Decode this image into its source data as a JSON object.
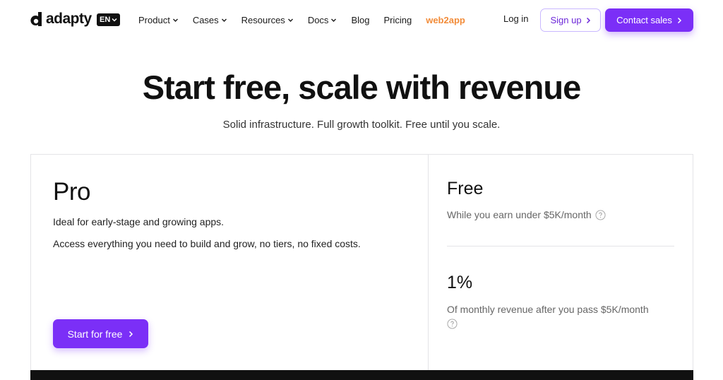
{
  "header": {
    "logo_text": "adapty",
    "language": "EN",
    "nav": [
      {
        "label": "Product",
        "dropdown": true
      },
      {
        "label": "Cases",
        "dropdown": true
      },
      {
        "label": "Resources",
        "dropdown": true
      },
      {
        "label": "Docs",
        "dropdown": true
      },
      {
        "label": "Blog",
        "dropdown": false
      },
      {
        "label": "Pricing",
        "dropdown": false
      },
      {
        "label": "web2app",
        "dropdown": false,
        "accent": true
      }
    ],
    "login_label": "Log in",
    "signup_label": "Sign up",
    "contact_label": "Contact sales"
  },
  "hero": {
    "title": "Start free, scale with revenue",
    "subtitle": "Solid infrastructure. Full growth toolkit. Free until you scale."
  },
  "plan": {
    "name": "Pro",
    "description": "Ideal for early-stage and growing apps.",
    "details": "Access everything you need to build and grow, no tiers, no fixed costs.",
    "cta_label": "Start for free"
  },
  "tiers": [
    {
      "title": "Free",
      "subtitle": "While you earn under $5K/month"
    },
    {
      "title": "1%",
      "subtitle": "Of monthly revenue after you pass $5K/month"
    }
  ],
  "colors": {
    "brand": "#7b2ff7",
    "accent_orange": "#f28c3a",
    "text": "#111111",
    "muted": "#666666"
  },
  "icons": [
    "logo-mark-icon",
    "chevron-down-icon",
    "chevron-right-icon",
    "help-circle-icon"
  ]
}
